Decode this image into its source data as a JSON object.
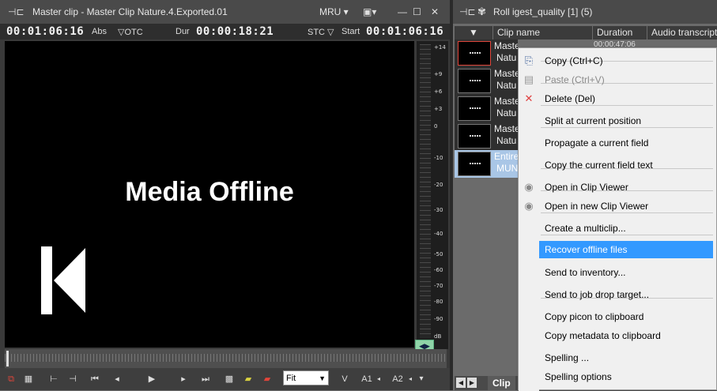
{
  "viewer": {
    "title": "Master clip - Master Clip Nature.4.Exported.01",
    "mru_label": "MRU",
    "timecode_position": "00:01:06:16",
    "abs_label": "Abs",
    "otc_label": "▽OTC",
    "dur_label": "Dur",
    "duration": "00:00:18:21",
    "stc_label": "STC ▽",
    "start_label": "Start",
    "start_timecode": "00:01:06:16",
    "media_offline_text": "Media Offline",
    "meter_ticks": [
      "+14",
      "+9",
      "+6",
      "+3",
      "0",
      "-10",
      "-20",
      "-30",
      "-40",
      "-50",
      "-60",
      "-70",
      "-80",
      "-90",
      "dB"
    ],
    "meter_button_label": "◀▶",
    "fit_value": "Fit",
    "v_label": "V",
    "a1_label": "A1",
    "a2_label": "A2"
  },
  "roll": {
    "title": "Roll  igest_quality [1] (5)",
    "columns": [
      "",
      "Clip name",
      "Duration",
      "Audio transcript"
    ],
    "first_row_duration": "00:00:47:06",
    "rows": [
      {
        "name_line1": "Master Clip",
        "name_line2": "Natu"
      },
      {
        "name_line1": "Maste",
        "name_line2": "Natu"
      },
      {
        "name_line1": "Maste",
        "name_line2": "Natu"
      },
      {
        "name_line1": "Maste",
        "name_line2": "Natu"
      },
      {
        "name_line1": "Entire",
        "name_line2": "MUN"
      }
    ],
    "bottom_tab": "Clip"
  },
  "context_menu": {
    "items": [
      {
        "label": "Copy (Ctrl+C)",
        "icon": "copy-icon",
        "disabled": false
      },
      {
        "label": "Paste (Ctrl+V)",
        "icon": "paste-icon",
        "disabled": true
      },
      {
        "label": "Delete (Del)",
        "icon": "delete-x-icon",
        "disabled": false
      },
      {
        "label": "Split at current position"
      },
      {
        "label": "Propagate a current field"
      },
      {
        "label": "Copy the current field text"
      },
      {
        "label": "Open in Clip Viewer",
        "icon": "eye-icon"
      },
      {
        "label": "Open in new Clip Viewer",
        "icon": "eye-icon"
      },
      {
        "label": "Create a multiclip..."
      },
      {
        "label": "Recover offline files",
        "highlighted": true
      },
      {
        "label": "Send to inventory..."
      },
      {
        "label": "Send to job drop target..."
      },
      {
        "label": "Copy picon to clipboard"
      },
      {
        "label": "Copy metadata to clipboard"
      },
      {
        "label": "Spelling ..."
      },
      {
        "label": "Spelling options"
      }
    ]
  },
  "colors": {
    "highlight": "#3399ff",
    "menu_bg": "#f0f0f0",
    "panel_bg": "#3a3a3a",
    "selected_thumb_border": "#e0453a"
  }
}
